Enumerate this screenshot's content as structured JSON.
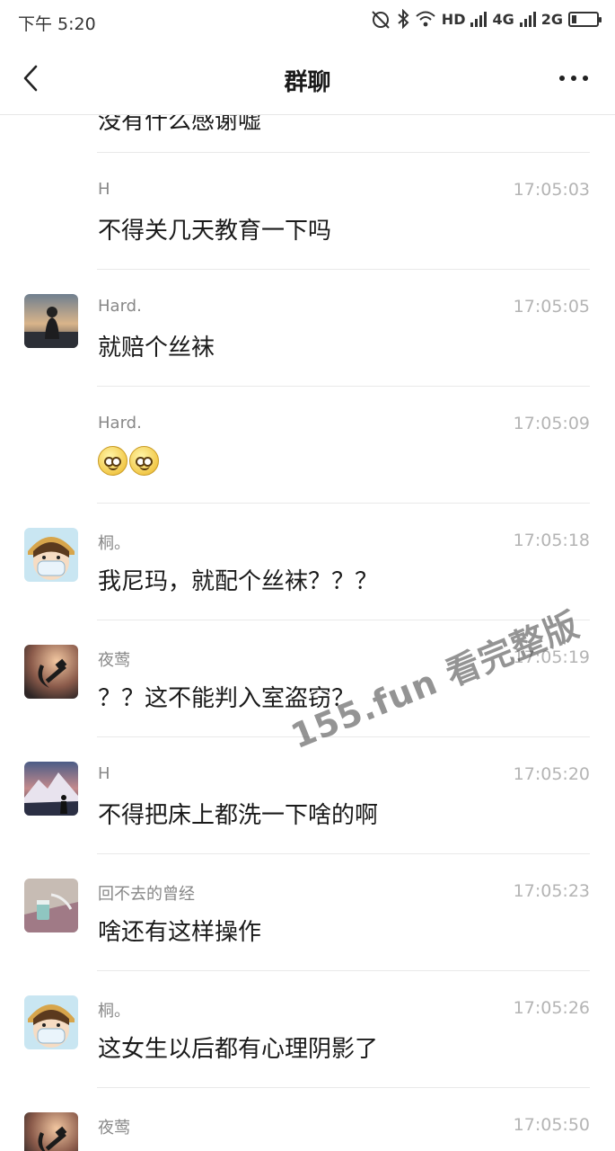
{
  "status_bar": {
    "time": "下午 5:20",
    "hd": "HD",
    "net1": "4G",
    "net2": "2G",
    "battery_level": 0.2
  },
  "header": {
    "title": "群聊"
  },
  "partial_message": {
    "text": "没有什么感谢嘘"
  },
  "messages": [
    {
      "name": "H",
      "time": "17:05:03",
      "text": "不得关几天教育一下吗",
      "avatar": "none"
    },
    {
      "name": "Hard.",
      "time": "17:05:05",
      "text": "就赔个丝袜",
      "avatar": "sunset-person-avatar"
    },
    {
      "name": "Hard.",
      "time": "17:05:09",
      "text": "",
      "emoji_count": 2,
      "avatar": "none"
    },
    {
      "name": "桐。",
      "time": "17:05:18",
      "text": "我尼玛，就配个丝袜？？？",
      "avatar": "anime-girl-mask-avatar"
    },
    {
      "name": "夜莺",
      "time": "17:05:19",
      "text": "？？这不能判入室盗窃？",
      "avatar": "hammer-sickle-avatar"
    },
    {
      "name": "H",
      "time": "17:05:20",
      "text": "不得把床上都洗一下啥的啊",
      "avatar": "mountain-person-avatar"
    },
    {
      "name": "回不去的曾经",
      "time": "17:05:23",
      "text": "啥还有这样操作",
      "avatar": "cup-avatar"
    },
    {
      "name": "桐。",
      "time": "17:05:26",
      "text": "这女生以后都有心理阴影了",
      "avatar": "anime-girl-mask-avatar"
    },
    {
      "name": "夜莺",
      "time": "17:05:50",
      "text": "",
      "avatar": "hammer-sickle-avatar"
    }
  ],
  "watermark": "155.fun 看完整版"
}
